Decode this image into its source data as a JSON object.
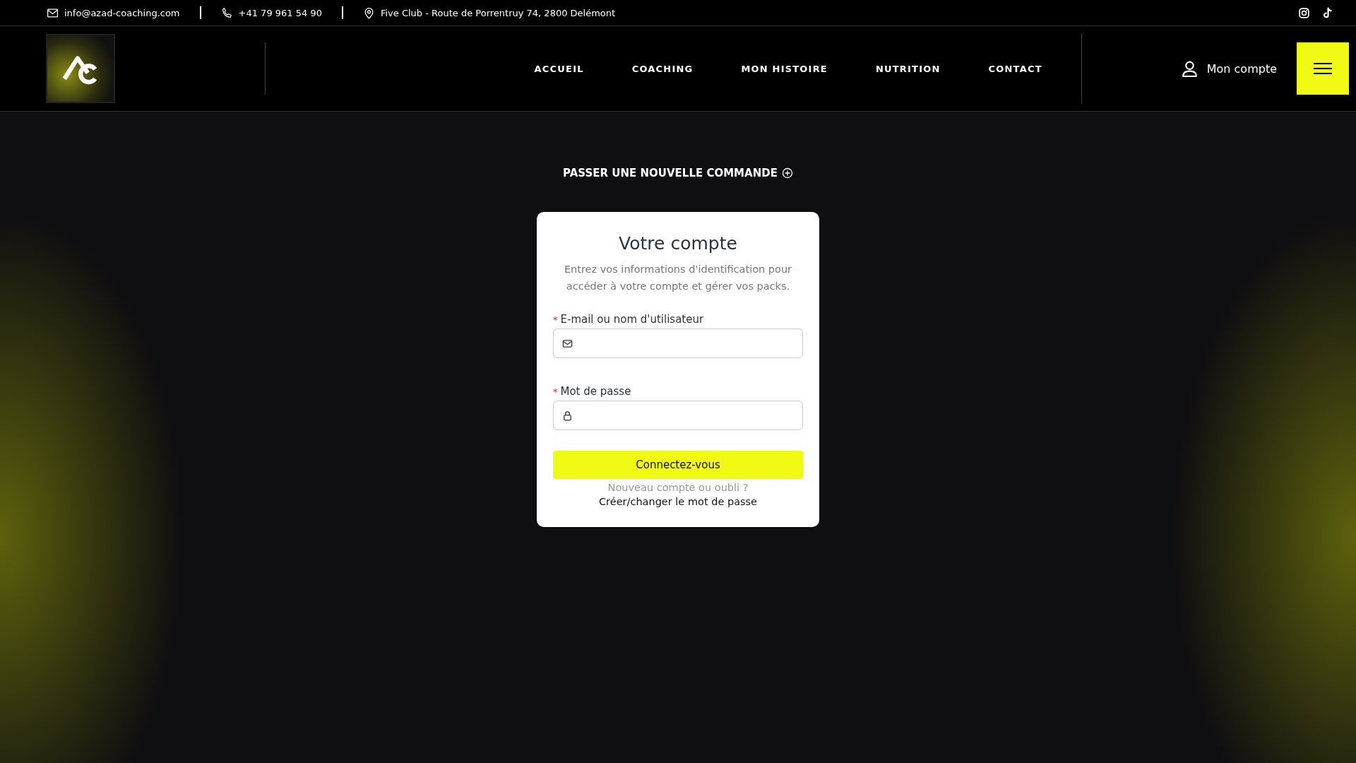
{
  "topbar": {
    "email": "info@azad-coaching.com",
    "phone": "+41 79 961 54 90",
    "address": "Five Club - Route de Porrentruy 74, 2800 Delémont"
  },
  "nav": [
    {
      "label": "ACCUEIL"
    },
    {
      "label": "COACHING"
    },
    {
      "label": "MON HISTOIRE"
    },
    {
      "label": "NUTRITION"
    },
    {
      "label": "CONTACT"
    }
  ],
  "account_link": "Mon compte",
  "new_order": "PASSER UNE NOUVELLE COMMANDE",
  "login": {
    "title": "Votre compte",
    "subtitle": "Entrez vos informations d'identification pour accéder à votre compte et gérer vos packs.",
    "fields": [
      {
        "kind": "email",
        "label": "E-mail ou nom d'utilisateur",
        "required_mark": "*"
      },
      {
        "kind": "password",
        "label": "Mot de passe",
        "required_mark": "*"
      }
    ],
    "submit": "Connectez-vous",
    "hint": "Nouveau compte ou oubli ?",
    "reset_link": "Créer/changer le mot de passe"
  }
}
